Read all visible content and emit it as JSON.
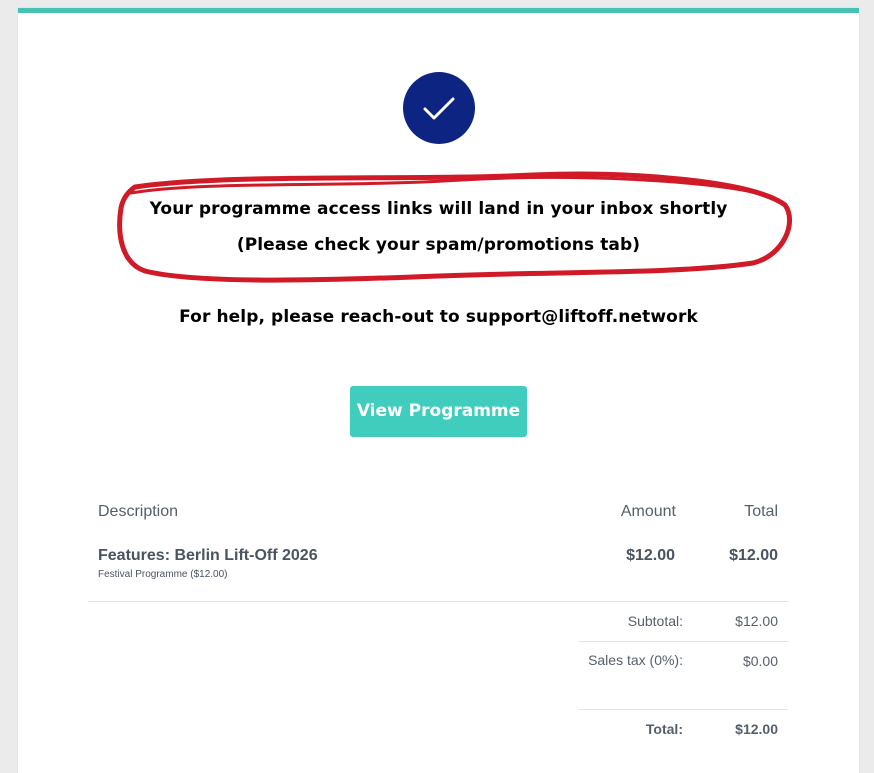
{
  "confirmation": {
    "line1": "Your programme access links will land in your inbox shortly",
    "line2": "(Please check your spam/promotions tab)",
    "help": "For help, please reach-out to support@liftoff.network",
    "button_label": "View Programme",
    "check_icon": "checkmark-icon"
  },
  "colors": {
    "top_border": "#46c2b5",
    "check_circle": "#0e2483",
    "button": "#41cdbd",
    "annotation": "#d01a28"
  },
  "invoice": {
    "headers": {
      "description": "Description",
      "amount": "Amount",
      "total": "Total"
    },
    "items": [
      {
        "name": "Features: Berlin Lift-Off 2026",
        "sub": "Festival Programme ($12.00)",
        "amount": "$12.00",
        "total": "$12.00"
      }
    ],
    "summary": {
      "subtotal_label": "Subtotal:",
      "subtotal_value": "$12.00",
      "tax_label": "Sales tax (0%):",
      "tax_value": "$0.00",
      "total_label": "Total:",
      "total_value": "$12.00"
    }
  }
}
